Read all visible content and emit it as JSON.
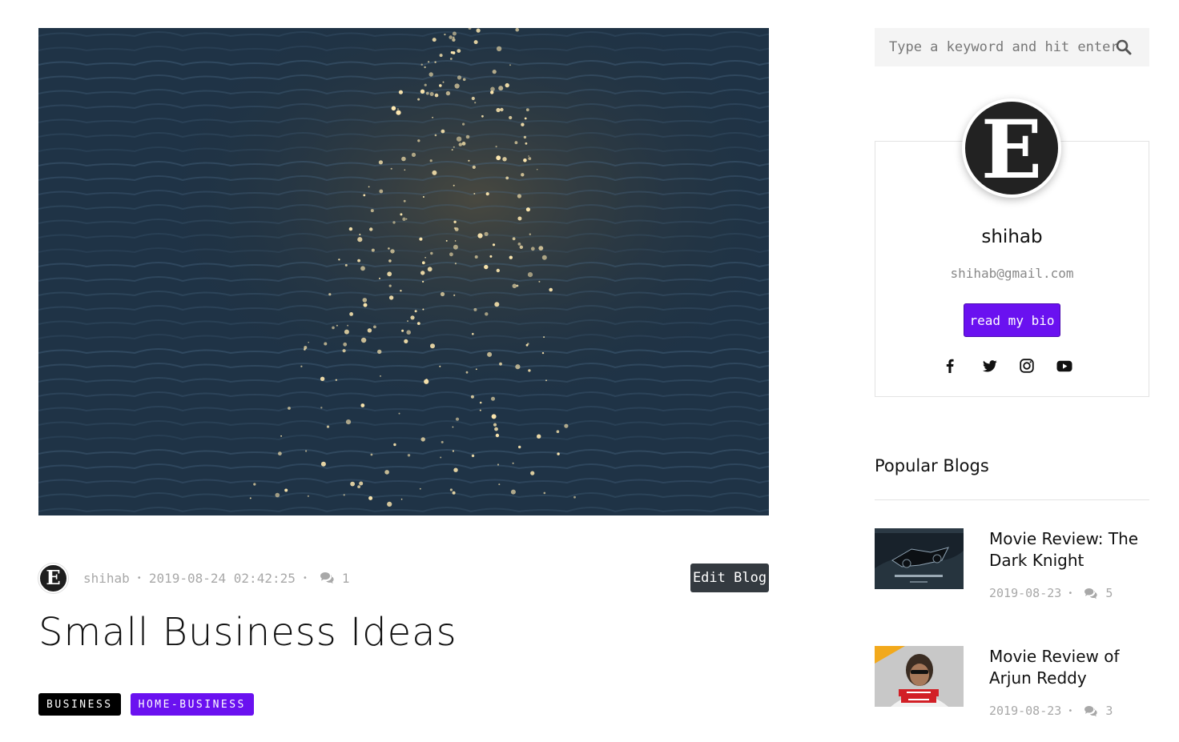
{
  "post": {
    "author": "shihab",
    "author_initial": "E",
    "date": "2019-08-24 02:42:25",
    "comments": "1",
    "edit_label": "Edit Blog",
    "title": "Small Business Ideas",
    "tags": [
      "BUSINESS",
      "HOME-BUSINESS"
    ]
  },
  "sidebar": {
    "search_placeholder": "Type a keyword and hit enter",
    "profile": {
      "initial": "E",
      "name": "shihab",
      "email": "shihab@gmail.com",
      "bio_button": "read my bio",
      "socials": [
        "facebook-icon",
        "twitter-icon",
        "instagram-icon",
        "youtube-icon"
      ]
    },
    "popular_title": "Popular Blogs",
    "popular": [
      {
        "title": "Movie Review: The Dark Knight",
        "date": "2019-08-23",
        "comments": "5"
      },
      {
        "title": "Movie Review of Arjun Reddy",
        "date": "2019-08-23",
        "comments": "3"
      }
    ]
  },
  "colors": {
    "accent": "#6a11f0",
    "dark_button": "#343a40",
    "meta_gray": "#a8a8a8"
  }
}
